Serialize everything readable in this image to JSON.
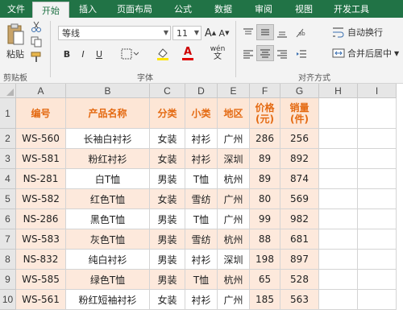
{
  "ribbon_tabs": [
    "文件",
    "开始",
    "插入",
    "页面布局",
    "公式",
    "数据",
    "审阅",
    "视图",
    "开发工具"
  ],
  "active_tab": "开始",
  "clipboard": {
    "paste_label": "粘贴",
    "group_label": "剪贴板"
  },
  "font": {
    "name": "等线",
    "size": "11",
    "group_label": "字体",
    "bold": "B",
    "italic": "I",
    "underline": "U",
    "phonetic": "wén",
    "font_color_glyph": "A"
  },
  "alignment": {
    "wrap_text": "自动换行",
    "merge_center": "合并后居中",
    "group_label": "对齐方式"
  },
  "columns": [
    "A",
    "B",
    "C",
    "D",
    "E",
    "F",
    "G",
    "H",
    "I"
  ],
  "rows": [
    "1",
    "2",
    "3",
    "4",
    "5",
    "6",
    "7",
    "8",
    "9",
    "10"
  ],
  "table": {
    "headers": [
      "编号",
      "产品名称",
      "分类",
      "小类",
      "地区",
      "价格\n(元)",
      "销量\n(件)"
    ],
    "rows": [
      [
        "WS-560",
        "长袖白衬衫",
        "女装",
        "衬衫",
        "广州",
        "286",
        "256"
      ],
      [
        "WS-581",
        "粉红衬衫",
        "女装",
        "衬衫",
        "深圳",
        "89",
        "892"
      ],
      [
        "NS-281",
        "白T恤",
        "男装",
        "T恤",
        "杭州",
        "89",
        "874"
      ],
      [
        "WS-582",
        "红色T恤",
        "女装",
        "雪纺",
        "广州",
        "80",
        "569"
      ],
      [
        "NS-286",
        "黑色T恤",
        "男装",
        "T恤",
        "广州",
        "99",
        "982"
      ],
      [
        "WS-583",
        "灰色T恤",
        "男装",
        "雪纺",
        "杭州",
        "88",
        "681"
      ],
      [
        "NS-832",
        "纯白衬衫",
        "男装",
        "衬衫",
        "深圳",
        "198",
        "897"
      ],
      [
        "WS-585",
        "绿色T恤",
        "男装",
        "T恤",
        "杭州",
        "65",
        "528"
      ],
      [
        "WS-561",
        "粉红短袖衬衫",
        "女装",
        "衬衫",
        "广州",
        "185",
        "563"
      ]
    ]
  },
  "colors": {
    "accent": "#217346",
    "header_fill": "#fde6d6",
    "header_text": "#e46a12",
    "band_fill": "#fde9dc"
  }
}
